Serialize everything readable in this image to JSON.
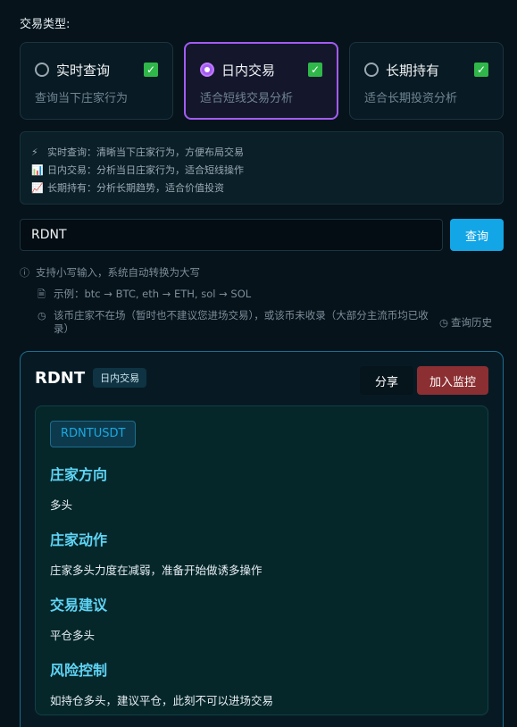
{
  "trade_type_label": "交易类型:",
  "trade_types": [
    {
      "title": "实时查询",
      "desc": "查询当下庄家行为",
      "selected": false,
      "checked": true
    },
    {
      "title": "日内交易",
      "desc": "适合短线交易分析",
      "selected": true,
      "checked": true
    },
    {
      "title": "长期持有",
      "desc": "适合长期投资分析",
      "selected": false,
      "checked": true
    }
  ],
  "info_lines": [
    {
      "icon": "lightning-icon",
      "glyph": "⚡",
      "text": "实时查询：清晰当下庄家行为，方便布局交易"
    },
    {
      "icon": "bar-chart-icon",
      "glyph": "📊",
      "text": "日内交易：分析当日庄家行为，适合短线操作"
    },
    {
      "icon": "trend-chart-icon",
      "glyph": "📈",
      "text": "长期持有：分析长期趋势，适合价值投资"
    }
  ],
  "search": {
    "value": "RDNT",
    "placeholder": "",
    "button": "查询"
  },
  "hints": {
    "lowercase": "支持小写输入，系统自动转换为大写",
    "example": "示例：btc → BTC, eth → ETH, sol → SOL",
    "warning": "该币庄家不在场（暂时也不建议您进场交易），或该币未收录（大部分主流币均已收录）",
    "history": "查询历史"
  },
  "result": {
    "symbol": "RDNT",
    "badge": "日内交易",
    "share": "分享",
    "watch": "加入监控",
    "pair": "RDNTUSDT",
    "sections": [
      {
        "title": "庄家方向",
        "text": "多头"
      },
      {
        "title": "庄家动作",
        "text": "庄家多头力度在减弱，准备开始做诱多操作"
      },
      {
        "title": "交易建议",
        "text": "平仓多头"
      },
      {
        "title": "风险控制",
        "text": "如持仓多头，建议平仓，此刻不可以进场交易"
      }
    ]
  },
  "colors": {
    "accent_purple": "#a35cf2",
    "accent_blue": "#13a6e6",
    "watch_red": "#8b2f32",
    "section_title": "#5fd4f5"
  }
}
